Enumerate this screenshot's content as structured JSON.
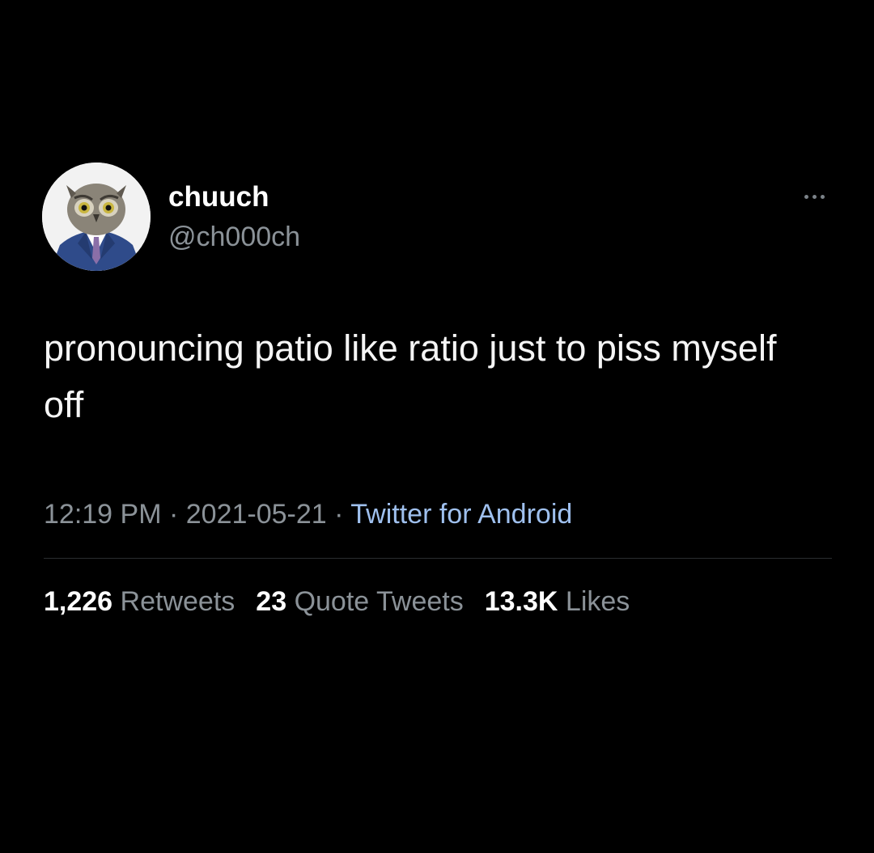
{
  "tweet": {
    "author": {
      "display_name": "chuuch",
      "handle": "@ch000ch",
      "avatar": "owl-in-suit-avatar"
    },
    "more_icon": "more-horizontal-icon",
    "text": "pronouncing patio like ratio just to piss myself off",
    "meta": {
      "time": "12:19 PM",
      "separator": " · ",
      "date": "2021-05-21",
      "source": "Twitter for Android"
    },
    "stats": {
      "retweets": {
        "count": "1,226",
        "label": "Retweets"
      },
      "quotes": {
        "count": "23",
        "label": "Quote Tweets"
      },
      "likes": {
        "count": "13.3K",
        "label": "Likes"
      }
    }
  },
  "colors": {
    "background": "#000000",
    "name": "#ffffff",
    "secondary_text": "#8b9298",
    "link": "#9fc0ee",
    "divider": "#2a2d30"
  }
}
